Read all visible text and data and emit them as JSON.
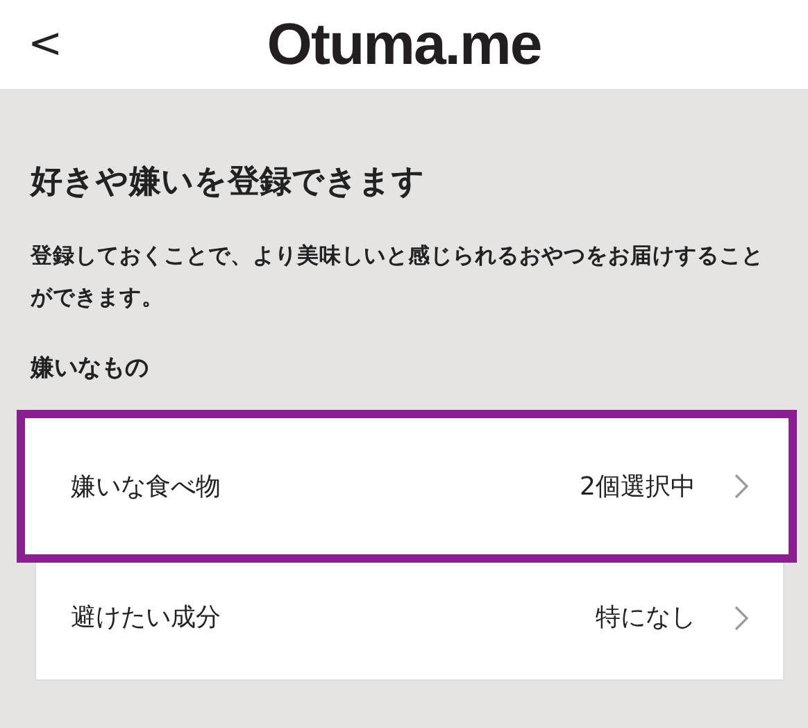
{
  "header": {
    "back": "<",
    "logo": "Otuma.me"
  },
  "title": "好きや嫌いを登録できます",
  "description": "登録しておくことで、より美味しいと感じられるおやつをお届けすることができます。",
  "section": {
    "heading": "嫌いなもの",
    "items": [
      {
        "label": "嫌いな食べ物",
        "value": "2個選択中",
        "highlighted": true
      },
      {
        "label": "避けたい成分",
        "value": "特になし",
        "highlighted": false
      }
    ]
  }
}
